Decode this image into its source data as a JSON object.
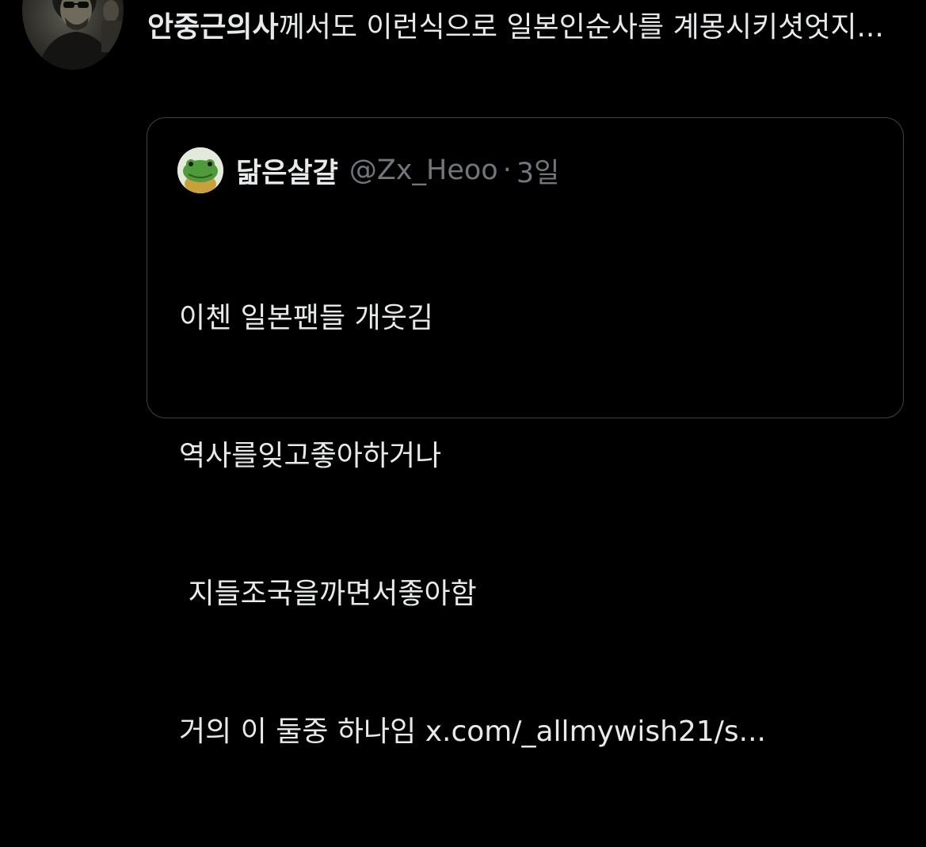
{
  "tweet": {
    "author_mention": "안중근의사",
    "text_rest": "께서도 이런식으로 일본인순사를 계몽시키셧엇지...",
    "avatar_icon": "profile-avatar"
  },
  "quote": {
    "name": "닮은살걀",
    "handle": "@Zx_Heoo",
    "separator": "·",
    "time": "3일",
    "avatar_icon": "frog-avatar",
    "lines": [
      "이첸 일본팬들 개웃김",
      "역사를잊고좋아하거나",
      " 지들조국을까면서좋아함",
      "거의 이 둘중 하나임 "
    ],
    "link_text": "x.com/_allmywish21/s..."
  },
  "colors": {
    "background": "#000000",
    "text": "#e7e9ea",
    "muted": "#71767b",
    "border": "#3e4144"
  }
}
